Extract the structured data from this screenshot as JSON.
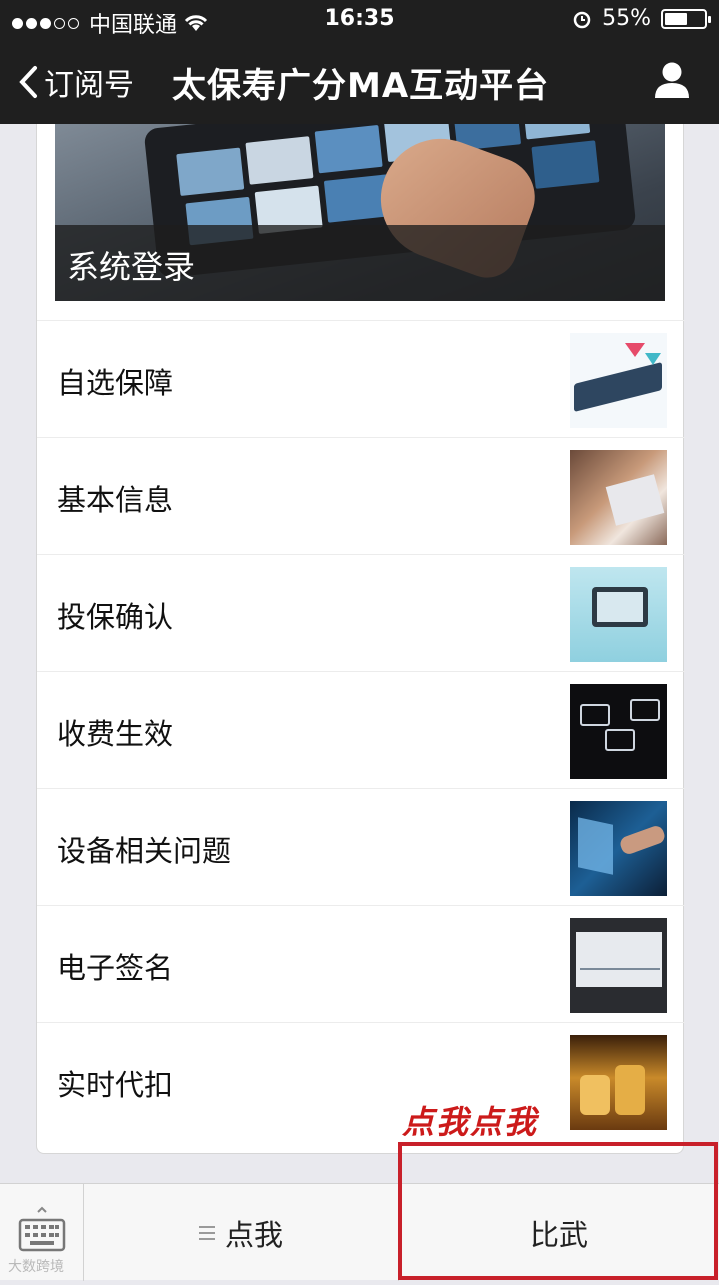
{
  "status_bar": {
    "carrier": "中国联通",
    "time": "16:35",
    "battery": "55%"
  },
  "nav": {
    "back_label": "订阅号",
    "title": "太保寿广分MA互动平台"
  },
  "banner": {
    "caption": "系统登录"
  },
  "menu_items": [
    {
      "label": "自选保障"
    },
    {
      "label": "基本信息"
    },
    {
      "label": "投保确认"
    },
    {
      "label": "收费生效"
    },
    {
      "label": "设备相关问题"
    },
    {
      "label": "电子签名"
    },
    {
      "label": "实时代扣"
    }
  ],
  "bottom_menu": {
    "item1": "点我",
    "item2": "比武"
  },
  "annotation": "点我点我",
  "watermark": "大数跨境",
  "colors": {
    "nav_bg": "#1f1f1f",
    "annotation_red": "#c8202a"
  }
}
